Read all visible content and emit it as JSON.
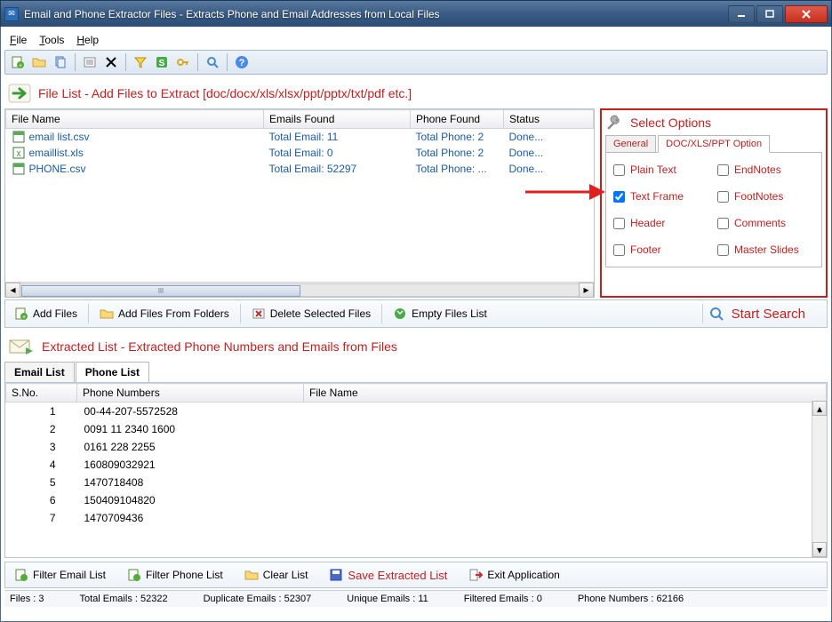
{
  "window": {
    "title": "Email and Phone Extractor Files  -  Extracts Phone and Email Addresses from Local Files"
  },
  "menu": {
    "file": "File",
    "tools": "Tools",
    "help": "Help"
  },
  "file_list": {
    "header": "File List - Add Files to Extract  [doc/docx/xls/xlsx/ppt/pptx/txt/pdf etc.]",
    "cols": {
      "name": "File Name",
      "emails": "Emails Found",
      "phone": "Phone Found",
      "status": "Status"
    },
    "rows": [
      {
        "name": "email list.csv",
        "emails": "Total Email: 11",
        "phone": "Total Phone: 2",
        "status": "Done..."
      },
      {
        "name": "emaillist.xls",
        "emails": "Total Email: 0",
        "phone": "Total Phone: 2",
        "status": "Done..."
      },
      {
        "name": "PHONE.csv",
        "emails": "Total Email: 52297",
        "phone": "Total Phone: ...",
        "status": "Done..."
      }
    ]
  },
  "options": {
    "title": "Select Options",
    "tabs": {
      "general": "General",
      "doc": "DOC/XLS/PPT Option"
    },
    "items": {
      "plain": "Plain Text",
      "endnotes": "EndNotes",
      "textframe": "Text Frame",
      "footnotes": "FootNotes",
      "header": "Header",
      "comments": "Comments",
      "footer": "Footer",
      "master": "Master Slides"
    }
  },
  "buttons": {
    "add_files": "Add Files",
    "add_folders": "Add Files From Folders",
    "delete_sel": "Delete Selected Files",
    "empty": "Empty Files List",
    "start": "Start Search"
  },
  "extracted": {
    "header": "Extracted List - Extracted Phone Numbers and Emails from Files",
    "tabs": {
      "email": "Email List",
      "phone": "Phone List"
    },
    "cols": {
      "sno": "S.No.",
      "phone": "Phone Numbers",
      "file": "File Name"
    },
    "rows": [
      {
        "sno": "1",
        "phone": "00-44-207-5572528"
      },
      {
        "sno": "2",
        "phone": "0091 11 2340 1600"
      },
      {
        "sno": "3",
        "phone": "0161 228 2255"
      },
      {
        "sno": "4",
        "phone": "160809032921"
      },
      {
        "sno": "5",
        "phone": "1470718408"
      },
      {
        "sno": "6",
        "phone": "150409104820"
      },
      {
        "sno": "7",
        "phone": "1470709436"
      }
    ]
  },
  "bottom": {
    "filter_email": "Filter Email List",
    "filter_phone": "Filter Phone List",
    "clear": "Clear List",
    "save": "Save Extracted List",
    "exit": "Exit Application"
  },
  "status": {
    "files": "Files :  3",
    "total": "Total Emails :  52322",
    "dup": "Duplicate Emails :  52307",
    "unique": "Unique Emails :  11",
    "filtered": "Filtered Emails :  0",
    "phones": "Phone Numbers :  62166"
  }
}
